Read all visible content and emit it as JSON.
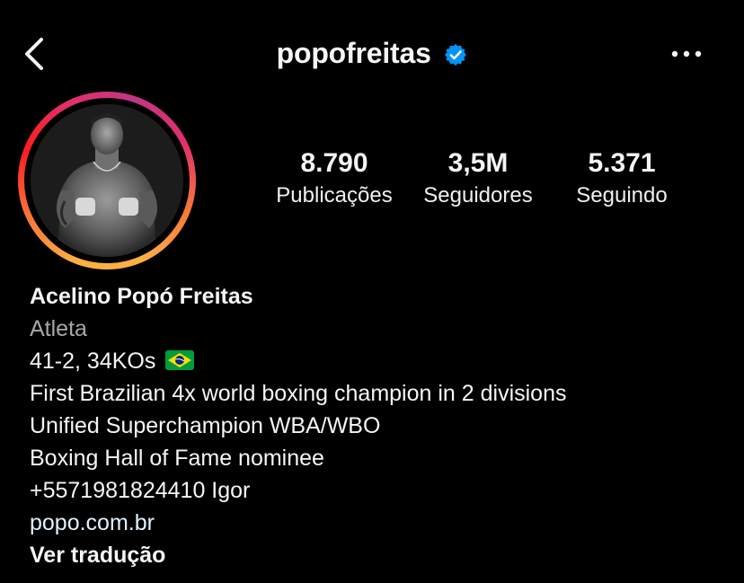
{
  "header": {
    "username": "popofreitas"
  },
  "stats": [
    {
      "value": "8.790",
      "label": "Publicações"
    },
    {
      "value": "3,5M",
      "label": "Seguidores"
    },
    {
      "value": "5.371",
      "label": "Seguindo"
    }
  ],
  "bio": {
    "name": "Acelino Popó Freitas",
    "category": "Atleta",
    "lines": [
      "41-2, 34KOs",
      "First Brazilian 4x world boxing champion in 2 divisions",
      "Unified Superchampion WBA/WBO",
      "Boxing Hall of Fame nominee",
      "+5571981824410 Igor"
    ],
    "link": "popo.com.br",
    "translate": "Ver tradução"
  },
  "colors": {
    "background": "#000000",
    "text": "#f5f5f5",
    "category": "#a8a8a8",
    "link": "#e0f1ff",
    "verified": "#0095f6"
  }
}
